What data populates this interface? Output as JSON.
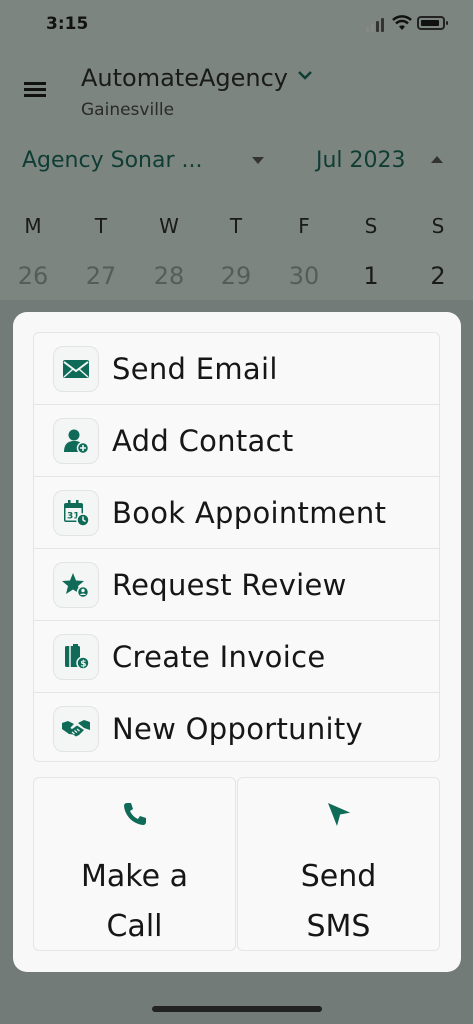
{
  "status_bar": {
    "time": "3:15"
  },
  "header": {
    "agency_name": "AutomateAgency",
    "agency_location": "Gainesville"
  },
  "calendar": {
    "calendar_select": "Agency Sonar ...",
    "month": "Jul 2023",
    "weekdays": [
      "M",
      "T",
      "W",
      "T",
      "F",
      "S",
      "S"
    ],
    "dates": [
      "26",
      "27",
      "28",
      "29",
      "30",
      "1",
      "2"
    ]
  },
  "quick_actions": {
    "menu": [
      {
        "label": "Send Email",
        "icon": "envelope-icon"
      },
      {
        "label": "Add Contact",
        "icon": "add-contact-icon"
      },
      {
        "label": "Book Appointment",
        "icon": "calendar-clock-icon"
      },
      {
        "label": "Request Review",
        "icon": "star-review-icon"
      },
      {
        "label": "Create Invoice",
        "icon": "invoice-icon"
      },
      {
        "label": "New Opportunity",
        "icon": "handshake-icon"
      }
    ],
    "call_label": "Make a\nCall",
    "sms_label": "Send\nSMS"
  },
  "colors": {
    "accent": "#0f6b58",
    "overlay": "#7d8581",
    "sheet": "#f7f8f7"
  }
}
